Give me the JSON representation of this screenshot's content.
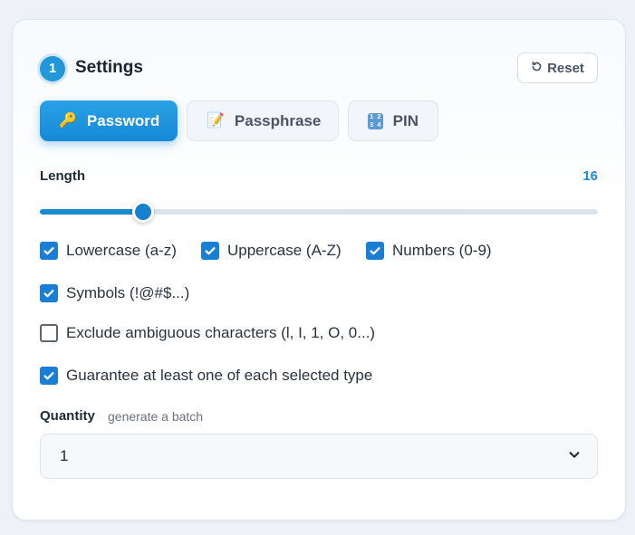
{
  "header": {
    "step_number": "1",
    "title": "Settings",
    "reset_label": "Reset"
  },
  "tabs": [
    {
      "label": "Password",
      "icon": "key-icon",
      "active": true
    },
    {
      "label": "Passphrase",
      "icon": "memo-icon",
      "active": false
    },
    {
      "label": "PIN",
      "icon": "input-numbers-icon",
      "active": false
    }
  ],
  "length": {
    "label": "Length",
    "value": "16",
    "slider_fraction": 0.185
  },
  "options": [
    {
      "label": "Lowercase (a-z)",
      "checked": true
    },
    {
      "label": "Uppercase (A-Z)",
      "checked": true
    },
    {
      "label": "Numbers (0-9)",
      "checked": true
    },
    {
      "label": "Symbols (!@#$...)",
      "checked": true
    },
    {
      "label": "Exclude ambiguous characters (l, I, 1, O, 0...)",
      "checked": false
    },
    {
      "label": "Guarantee at least one of each selected type",
      "checked": true
    }
  ],
  "quantity": {
    "label": "Quantity",
    "hint": "generate a batch",
    "selected": "1"
  },
  "colors": {
    "accent": "#1b8ad3",
    "checkbox": "#1a7fd4"
  }
}
